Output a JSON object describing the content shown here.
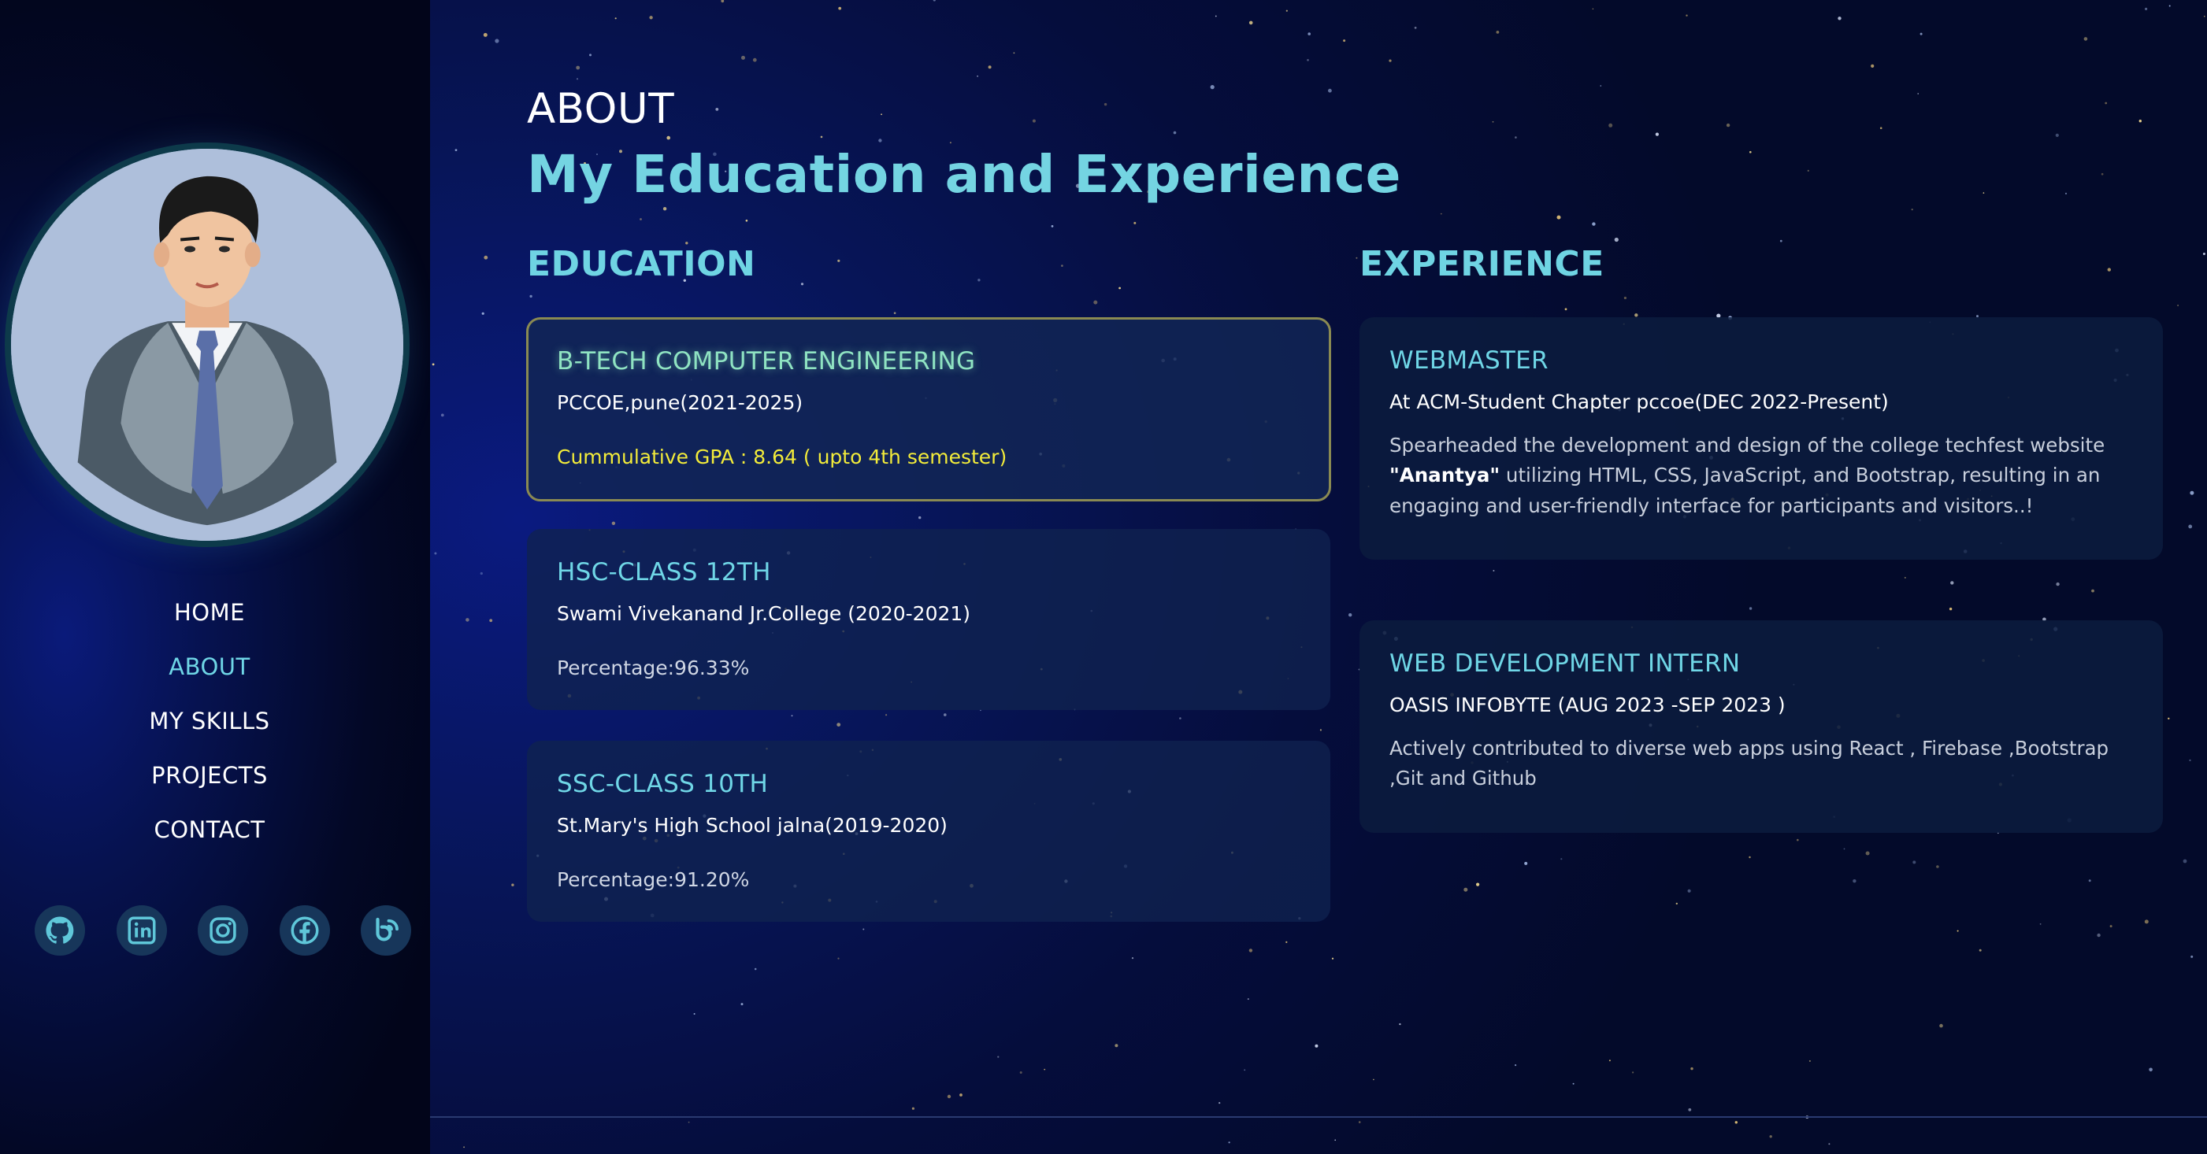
{
  "sidebar": {
    "nav": [
      {
        "label": "HOME"
      },
      {
        "label": "ABOUT",
        "active": true
      },
      {
        "label": "MY SKILLS"
      },
      {
        "label": "PROJECTS"
      },
      {
        "label": "CONTACT"
      }
    ],
    "socials": [
      {
        "icon": "github-icon"
      },
      {
        "icon": "linkedin-icon"
      },
      {
        "icon": "instagram-icon"
      },
      {
        "icon": "facebook-icon"
      },
      {
        "icon": "blog-icon"
      }
    ]
  },
  "main": {
    "eyebrow": "ABOUT",
    "heading": "My Education and Experience",
    "education": {
      "title": "EDUCATION",
      "items": [
        {
          "title": "B-TECH COMPUTER ENGINEERING",
          "sub": "PCCOE,pune(2021-2025)",
          "detail": "Cummulative GPA : 8.64 ( upto 4th semester)"
        },
        {
          "title": "HSC-CLASS 12TH",
          "sub": "Swami Vivekanand Jr.College (2020-2021)",
          "detail": "Percentage:96.33%"
        },
        {
          "title": "SSC-CLASS 10TH",
          "sub": "St.Mary's High School jalna(2019-2020)",
          "detail": "Percentage:91.20%"
        }
      ]
    },
    "experience": {
      "title": "EXPERIENCE",
      "items": [
        {
          "title": "WEBMASTER",
          "sub": "At ACM-Student Chapter pccoe(DEC 2022-Present)",
          "desc_before": "Spearheaded the development and design of the college techfest website ",
          "desc_bold": "\"Anantya\"",
          "desc_after": " utilizing HTML, CSS, JavaScript, and Bootstrap, resulting in an engaging and user-friendly interface for participants and visitors..!"
        },
        {
          "title": "WEB DEVELOPMENT INTERN",
          "sub": "OASIS INFOBYTE (AUG 2023 -SEP 2023 )",
          "desc": "Actively contributed to diverse web apps using React , Firebase ,Bootstrap ,Git and Github"
        }
      ]
    }
  },
  "colors": {
    "accent": "#6fd6e6",
    "gpa": "#f3ec3a",
    "bg": "#050d3c"
  }
}
